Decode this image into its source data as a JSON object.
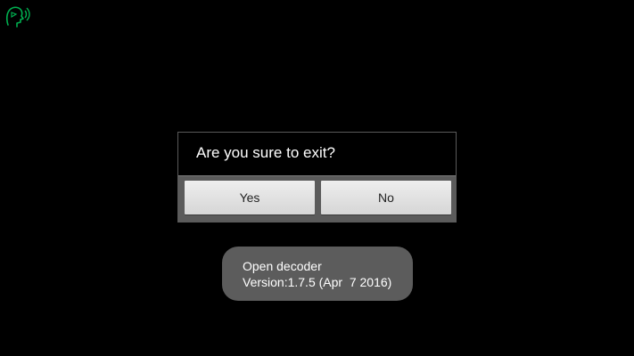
{
  "dialog": {
    "message": "Are you sure to exit?",
    "yes_label": "Yes",
    "no_label": "No"
  },
  "toast": {
    "line1": "Open decoder",
    "line2": "Version:1.7.5 (Apr  7 2016)"
  },
  "icons": {
    "app_icon": "head-with-sound-icon"
  },
  "colors": {
    "background": "#000000",
    "app_icon": "#00b050",
    "button_bar": "#5b5b5b",
    "toast_bg": "#5c5c5c"
  }
}
